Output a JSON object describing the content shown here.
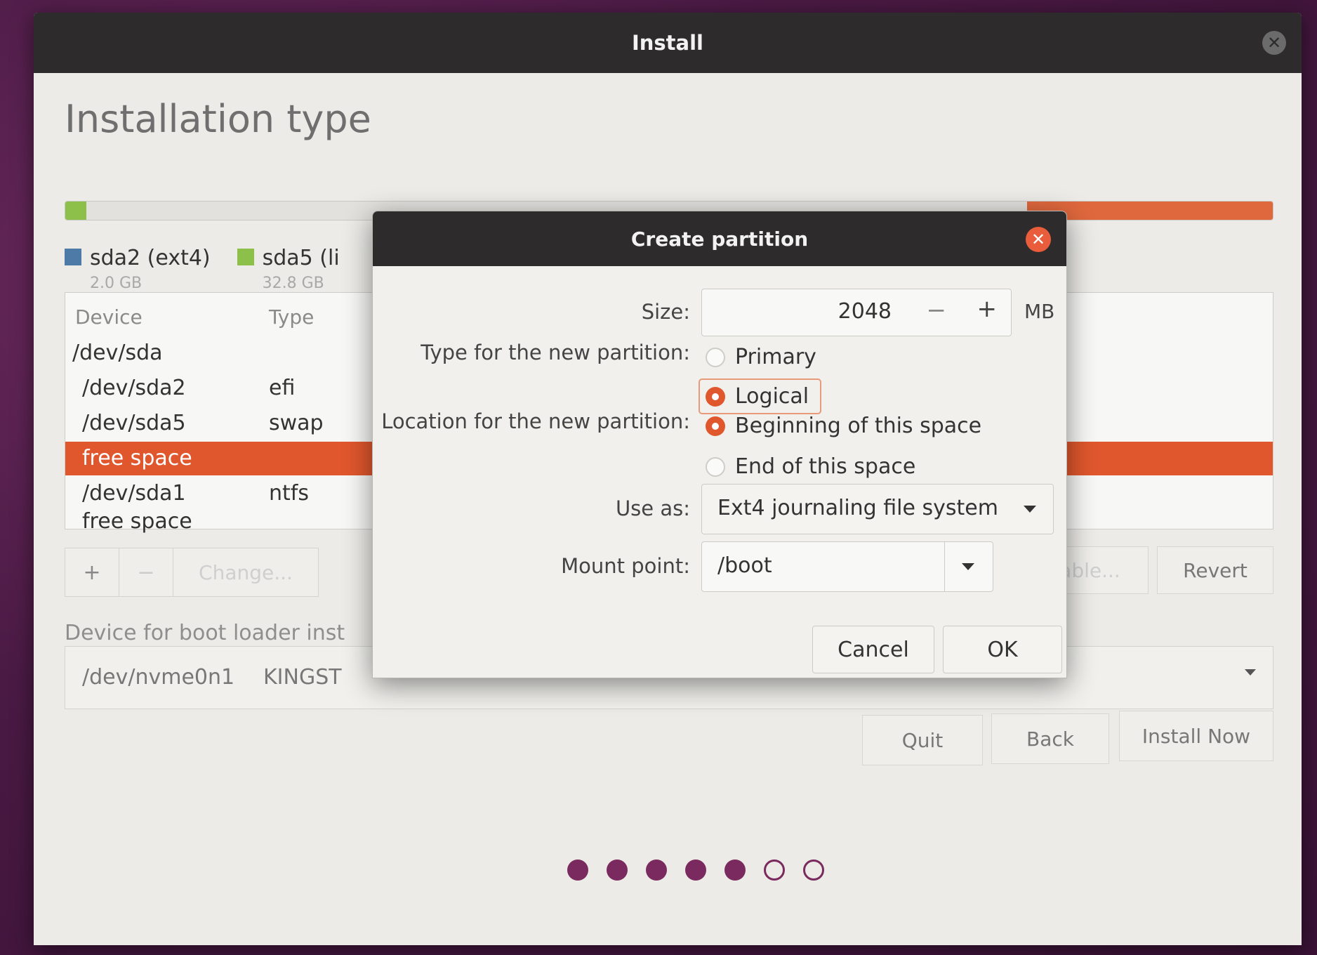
{
  "window": {
    "title": "Install"
  },
  "page": {
    "title": "Installation type"
  },
  "legend": [
    {
      "name": "sda2 (ext4)",
      "size": "2.0 GB",
      "color": "#4d7aa6"
    },
    {
      "name": "sda5 (li",
      "size": "32.8 GB",
      "color": "#8cc04a"
    }
  ],
  "table": {
    "headers": {
      "device": "Device",
      "type": "Type"
    },
    "rows": [
      {
        "device": "/dev/sda",
        "type": ""
      },
      {
        "device": "/dev/sda2",
        "type": "efi"
      },
      {
        "device": "/dev/sda5",
        "type": "swap"
      },
      {
        "device": "free space",
        "type": "",
        "selected": true
      },
      {
        "device": "/dev/sda1",
        "type": "ntfs"
      },
      {
        "device": "free space",
        "type": ""
      }
    ]
  },
  "tools": {
    "add": "+",
    "remove": "−",
    "change": "Change..."
  },
  "partition_buttons": {
    "new_table": "tion Table...",
    "revert": "Revert"
  },
  "bootloader": {
    "label": "Device for boot loader inst",
    "device": "/dev/nvme0n1",
    "model": "KINGST"
  },
  "nav": {
    "quit": "Quit",
    "back": "Back",
    "install": "Install Now"
  },
  "progress_dots": {
    "total": 7,
    "completed": 5
  },
  "dialog": {
    "title": "Create partition",
    "size_label": "Size:",
    "size_value": "2048",
    "size_minus": "−",
    "size_plus": "+",
    "size_unit": "MB",
    "type_label": "Type for the new partition:",
    "type_primary": "Primary",
    "type_logical": "Logical",
    "location_label": "Location for the new partition:",
    "location_begin": "Beginning of this space",
    "location_end": "End of this space",
    "use_as_label": "Use as:",
    "use_as_value": "Ext4 journaling file system",
    "mount_label": "Mount point:",
    "mount_value": "/boot",
    "cancel": "Cancel",
    "ok": "OK"
  },
  "colors": {
    "accent": "#e0572d",
    "titlebar": "#2d2b2b",
    "dot": "#7a2a5e"
  }
}
